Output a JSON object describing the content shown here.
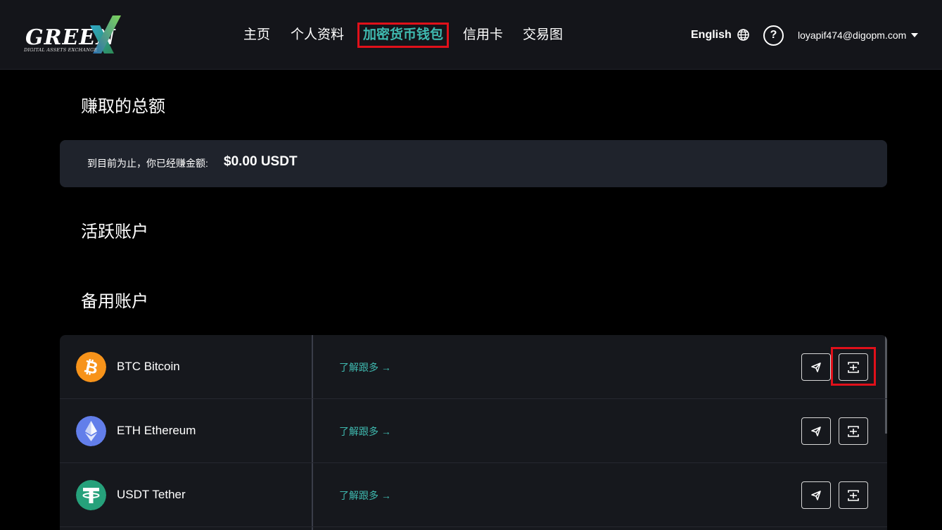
{
  "brand": {
    "logo_text": "GREEN",
    "logo_sub": "DIGITAL ASSETS EXCHANGE"
  },
  "nav": [
    {
      "label": "主页",
      "active": false
    },
    {
      "label": "个人资料",
      "active": false
    },
    {
      "label": "加密货币钱包",
      "active": true
    },
    {
      "label": "信用卡",
      "active": false
    },
    {
      "label": "交易图",
      "active": false
    }
  ],
  "header": {
    "language": "English",
    "help_label": "?",
    "email": "loyapif474@digopm.com"
  },
  "earnings": {
    "title": "赚取的总额",
    "label": "到目前为止，你已经赚金额:",
    "amount": "$0.00 USDT"
  },
  "active_accounts": {
    "title": "活跃账户"
  },
  "backup_accounts": {
    "title": "备用账户",
    "rows": [
      {
        "name": "BTC Bitcoin",
        "link": "了解跟多 →",
        "icon": "bitcoin-icon",
        "color": "#f7931a"
      },
      {
        "name": "ETH Ethereum",
        "link": "了解跟多 →",
        "icon": "ethereum-icon",
        "color": "#627eea"
      },
      {
        "name": "USDT Tether",
        "link": "了解跟多 →",
        "icon": "tether-icon",
        "color": "#26a17b"
      }
    ]
  },
  "colors": {
    "accent": "#3fbab0",
    "highlight": "#e0101a",
    "panel": "#1f232c"
  }
}
